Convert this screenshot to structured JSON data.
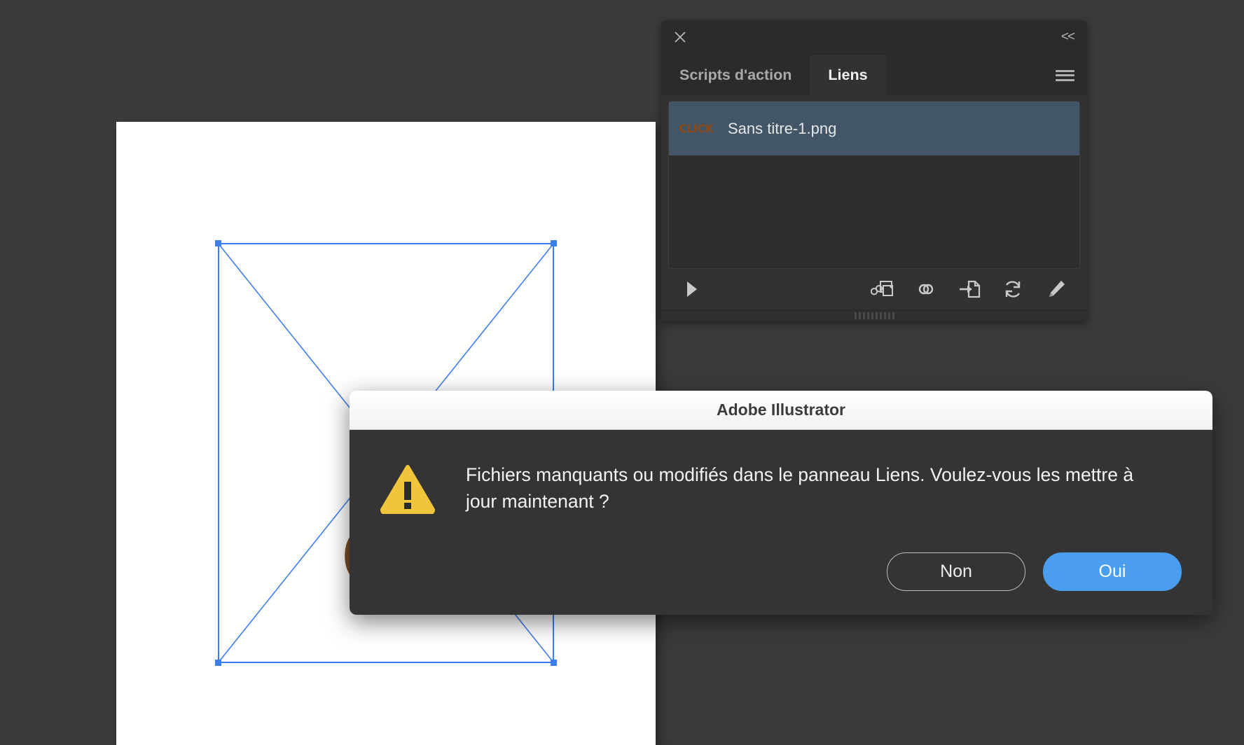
{
  "canvas": {
    "artwork_text": "CL",
    "artwork_color": "#7a4f25",
    "selection_color": "#3b7ef0"
  },
  "links_panel": {
    "close_icon": "close-icon",
    "collapse_label": "<<",
    "menu_icon": "hamburger-menu-icon",
    "tabs": [
      {
        "label": "Scripts d'action",
        "active": false
      },
      {
        "label": "Liens",
        "active": true
      }
    ],
    "items": [
      {
        "name": "Sans titre-1.png",
        "thumbnail_text": "CLICK",
        "thumbnail_color": "#8a4a1c",
        "selected": true
      }
    ],
    "selection_color": "#425668",
    "toolbar": [
      {
        "icon": "play-triangle-icon",
        "name": "show-link-info-button"
      },
      {
        "icon": "relink-from-library-icon",
        "name": "relink-from-library-button"
      },
      {
        "icon": "chain-link-icon",
        "name": "relink-button"
      },
      {
        "icon": "go-to-link-icon",
        "name": "go-to-link-button"
      },
      {
        "icon": "refresh-icon",
        "name": "update-link-button"
      },
      {
        "icon": "pencil-icon",
        "name": "edit-original-button"
      }
    ]
  },
  "dialog": {
    "title": "Adobe Illustrator",
    "icon": "warning-triangle-icon",
    "icon_color": "#f0c53c",
    "message": "Fichiers manquants ou modifiés dans le panneau Liens. Voulez-vous les mettre à jour maintenant ?",
    "buttons": {
      "no_label": "Non",
      "yes_label": "Oui",
      "primary_color": "#4a9eed"
    }
  }
}
